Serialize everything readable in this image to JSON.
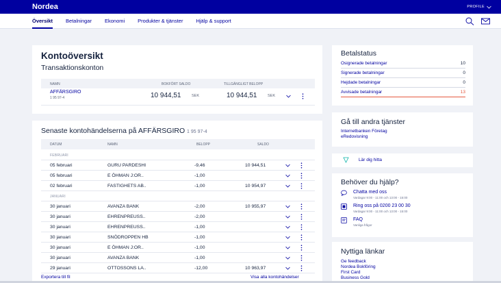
{
  "brand": {
    "logo": "Nordea",
    "profile_label": "PROFILE"
  },
  "nav": {
    "items": [
      "Översikt",
      "Betalningar",
      "Ekonomi",
      "Produkter & tjänster",
      "Hjälp & support"
    ]
  },
  "overview": {
    "title": "Kontoöversikt",
    "subtitle": "Transaktionskonton",
    "columns": {
      "name": "NAMN",
      "booked": "BOKFÖRT SALDO",
      "available": "TILLGÄNGLIGT BELOPP"
    },
    "account": {
      "name": "AFFÄRSGIRO",
      "number": "1 95 97-4",
      "booked": "10 944,51",
      "booked_currency": "SEK",
      "available": "10 944,51",
      "available_currency": "SEK"
    }
  },
  "events": {
    "title": "Senaste kontohändelserna på AFFÄRSGIRO",
    "account_number": "1 95 97-4",
    "columns": {
      "date": "DATUM",
      "name": "NAMN",
      "amount": "BELOPP",
      "balance": "SALDO"
    },
    "groups": [
      {
        "label": "FEBRUARI",
        "rows": [
          {
            "date": "05 februari",
            "name": "GURU PARDESHI",
            "amount": "-9,46",
            "balance": "10 944,51"
          },
          {
            "date": "05 februari",
            "name": "E ÖHMAN J:OR..",
            "amount": "-1,00",
            "balance": ""
          },
          {
            "date": "02 februari",
            "name": "FASTIGHETS AB..",
            "amount": "-1,00",
            "balance": "10 954,97"
          }
        ]
      },
      {
        "label": "JANUARI",
        "rows": [
          {
            "date": "30 januari",
            "name": "AVANZA BANK",
            "amount": "-2,00",
            "balance": "10 955,97"
          },
          {
            "date": "30 januari",
            "name": "EHRENPREUSS..",
            "amount": "-2,00",
            "balance": ""
          },
          {
            "date": "30 januari",
            "name": "EHRENPREUSS..",
            "amount": "-1,00",
            "balance": ""
          },
          {
            "date": "30 januari",
            "name": "SNÖDROPPEN HB",
            "amount": "-1,00",
            "balance": ""
          },
          {
            "date": "30 januari",
            "name": "E ÖHMAN J:OR..",
            "amount": "-1,00",
            "balance": ""
          },
          {
            "date": "30 januari",
            "name": "AVANZA BANK",
            "amount": "-1,00",
            "balance": ""
          },
          {
            "date": "29 januari",
            "name": "OTTOSSONS LA..",
            "amount": "-12,00",
            "balance": "10 963,97"
          }
        ]
      }
    ],
    "export_label": "Exportera till fil",
    "show_all_label": "Visa alla kontohändelser"
  },
  "payment_status": {
    "title": "Betalstatus",
    "rows": [
      {
        "label": "Osignerade betalningar",
        "value": "10",
        "alert": false
      },
      {
        "label": "Signerade betalningar",
        "value": "0",
        "alert": false
      },
      {
        "label": "Hejdade betalningar",
        "value": "0",
        "alert": false
      },
      {
        "label": "Avvisade betalningar",
        "value": "13",
        "alert": true
      }
    ]
  },
  "other_services": {
    "title": "Gå till andra tjänster",
    "links": [
      "Internetbanken Företag",
      "eRedovisning"
    ]
  },
  "learn": {
    "label": "Lär dig hitta"
  },
  "help": {
    "title": "Behöver du hjälp?",
    "items": [
      {
        "icon": "chat-icon",
        "title": "Chatta med oss",
        "sub": "Vardagar 9:00 - 11:00 och 13:00 - 15:00"
      },
      {
        "icon": "phone-icon",
        "title": "Ring oss på 0200 23 00 30",
        "sub": "Vardagar 9:00 - 11:00 och 13:00 - 15:00"
      },
      {
        "icon": "faq-icon",
        "title": "FAQ",
        "sub": "Vanliga frågor"
      }
    ]
  },
  "useful_links": {
    "title": "Nyttiga länkar",
    "links": [
      "Ge feedback",
      "Nordea Bokföring",
      "First Card",
      "Business Gold"
    ]
  },
  "colors": {
    "brand": "#0000a0",
    "alert": "#e4573d",
    "teal": "#0ab2a8"
  }
}
